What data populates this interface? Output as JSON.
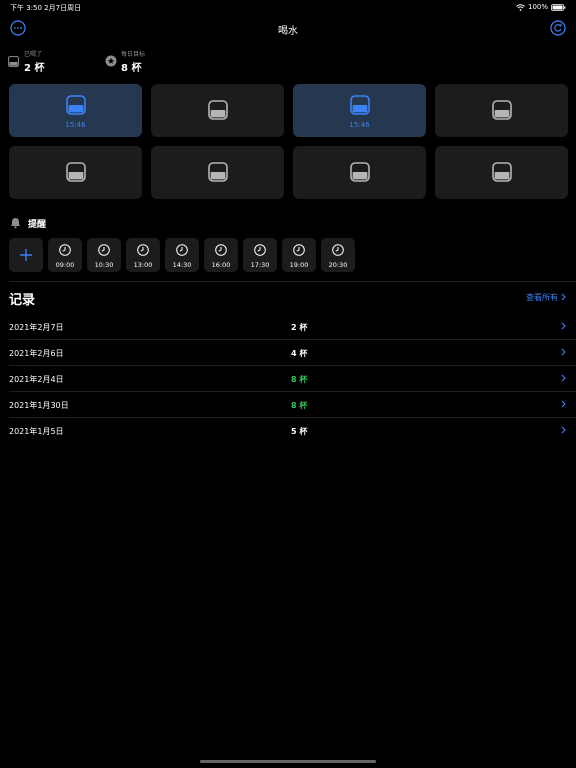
{
  "status_bar": {
    "time_date": "下午 3:50   2月7日周日",
    "battery": "100%",
    "icons": [
      "wifi-icon",
      "battery-icon"
    ]
  },
  "nav": {
    "title": "喝水",
    "left_icon": "more-icon",
    "right_icon": "refresh-icon"
  },
  "stats": {
    "drunk_label": "已喝了",
    "drunk_value": "2 杯",
    "goal_label": "每日目标",
    "goal_value": "8 杯"
  },
  "cups": [
    {
      "filled": true,
      "time": "15:46"
    },
    {
      "filled": false,
      "time": ""
    },
    {
      "filled": true,
      "time": "15:46"
    },
    {
      "filled": false,
      "time": ""
    },
    {
      "filled": false,
      "time": ""
    },
    {
      "filled": false,
      "time": ""
    },
    {
      "filled": false,
      "time": ""
    },
    {
      "filled": false,
      "time": ""
    }
  ],
  "reminder": {
    "title": "提醒",
    "times": [
      "09:00",
      "10:30",
      "13:00",
      "14:30",
      "16:00",
      "17:30",
      "19:00",
      "20:30"
    ]
  },
  "records": {
    "title": "记录",
    "view_all": "查看所有",
    "rows": [
      {
        "date": "2021年2月7日",
        "count": "2 杯",
        "met": false
      },
      {
        "date": "2021年2月6日",
        "count": "4 杯",
        "met": false
      },
      {
        "date": "2021年2月4日",
        "count": "8 杯",
        "met": true
      },
      {
        "date": "2021年1月30日",
        "count": "8 杯",
        "met": true
      },
      {
        "date": "2021年1月5日",
        "count": "5 杯",
        "met": false
      }
    ]
  },
  "colors": {
    "accent": "#3b82f6",
    "success": "#34c759",
    "card": "#1c1c1e",
    "card_filled": "#253850"
  }
}
